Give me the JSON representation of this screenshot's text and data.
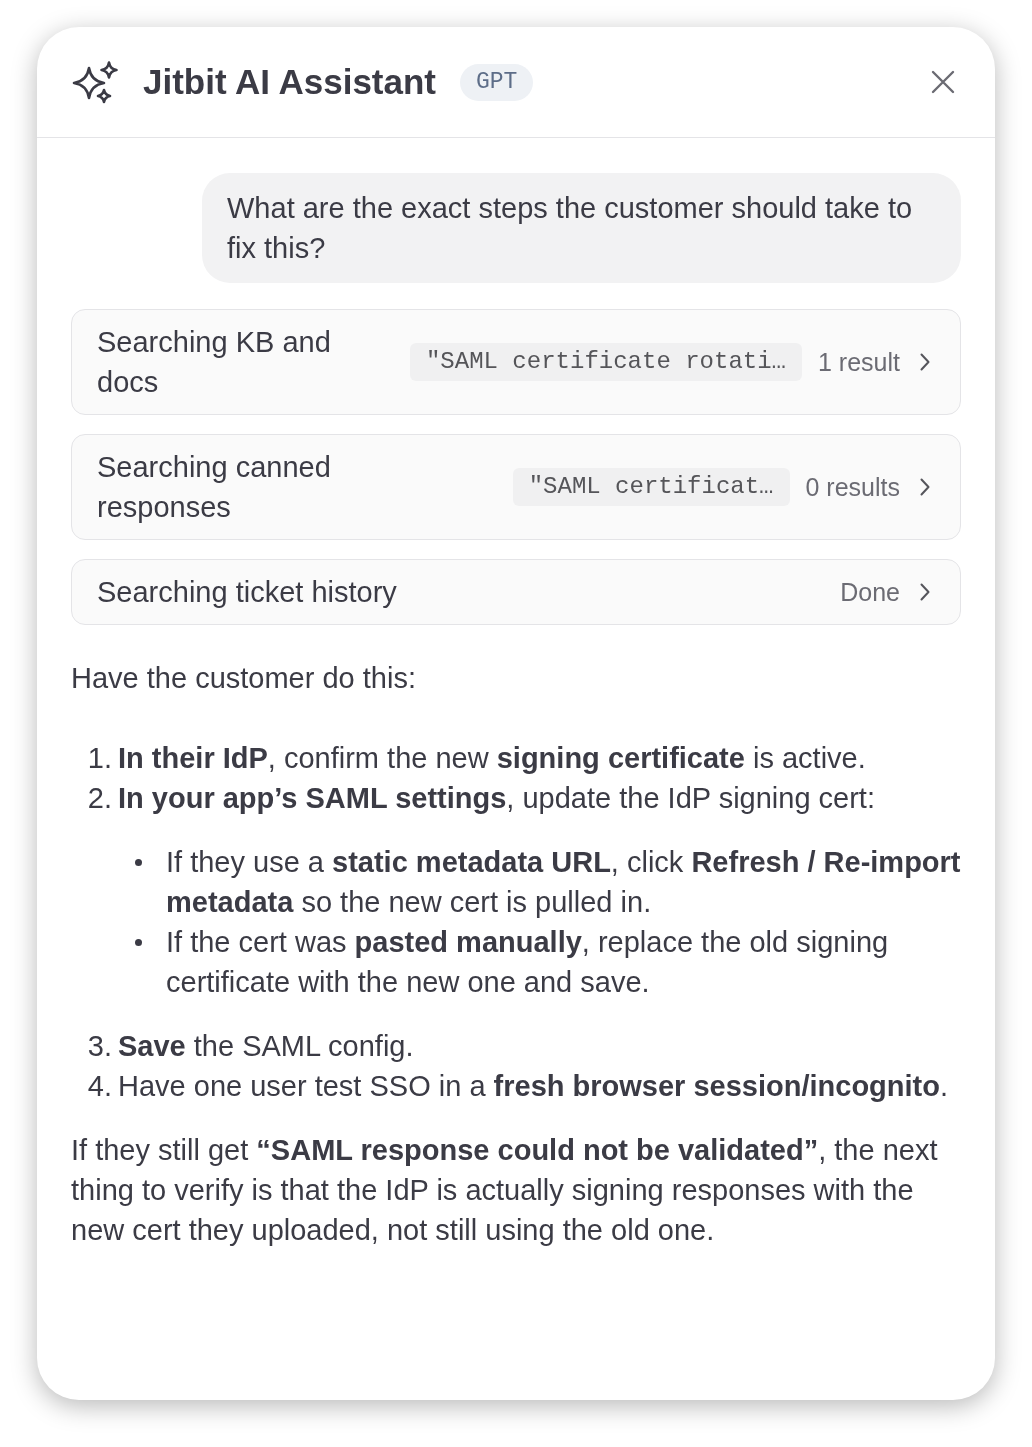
{
  "header": {
    "title": "Jitbit AI Assistant",
    "badge": "GPT"
  },
  "user_message": {
    "text": "What are the exact steps the customer should take to fix this?"
  },
  "tool_steps": [
    {
      "label": "Searching KB and docs",
      "query": "\"SAML certificate rotati…",
      "result": "1 result"
    },
    {
      "label": "Searching canned responses",
      "query": "\"SAML certificat…",
      "result": "0 results"
    },
    {
      "label": "Searching ticket history",
      "result": "Done"
    }
  ],
  "answer": {
    "intro": "Have the customer do this:",
    "steps": [
      {
        "number": "1.",
        "text": "**In their IdP**, confirm the new **signing certificate** is active."
      },
      {
        "number": "2.",
        "text": "**In your app’s SAML settings**, update the IdP signing cert:",
        "children": [
          {
            "text": "If they use a **static metadata URL**, click **Refresh / Re-import metadata** so the new cert is pulled in."
          },
          {
            "text": "If the cert was **pasted manually**, replace the old signing certificate with the new one and save."
          }
        ]
      },
      {
        "number": "3.",
        "text": "**Save** the SAML config."
      },
      {
        "number": "4.",
        "text": "Have one user test SSO in a **fresh browser session/incognito**."
      }
    ],
    "closing": "If they still get **“SAML response could not be validated”**, the next thing to verify is that the IdP is actually signing responses with the new cert they uploaded, not still using the old one."
  }
}
